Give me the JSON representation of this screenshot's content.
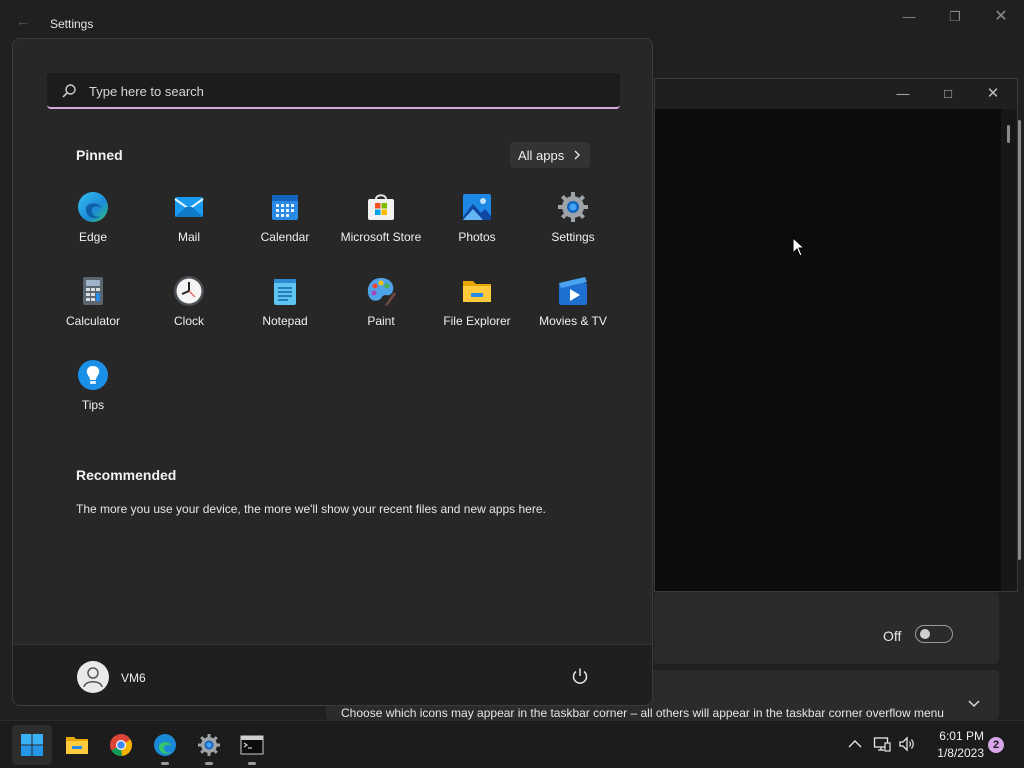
{
  "settings": {
    "title": "Settings",
    "toggle_state_label": "Off",
    "overflow_description": "Choose which icons may appear in the taskbar corner – all others will appear in the taskbar corner overflow menu"
  },
  "start_menu": {
    "search": {
      "placeholder": "Type here to search"
    },
    "pinned_title": "Pinned",
    "all_apps_label": "All apps",
    "pinned_apps": [
      {
        "label": "Edge",
        "icon": "edge-icon"
      },
      {
        "label": "Mail",
        "icon": "mail-icon"
      },
      {
        "label": "Calendar",
        "icon": "calendar-icon"
      },
      {
        "label": "Microsoft Store",
        "icon": "store-icon"
      },
      {
        "label": "Photos",
        "icon": "photos-icon"
      },
      {
        "label": "Settings",
        "icon": "gear-icon"
      },
      {
        "label": "Calculator",
        "icon": "calculator-icon"
      },
      {
        "label": "Clock",
        "icon": "clock-icon"
      },
      {
        "label": "Notepad",
        "icon": "notepad-icon"
      },
      {
        "label": "Paint",
        "icon": "paint-icon"
      },
      {
        "label": "File Explorer",
        "icon": "folder-icon"
      },
      {
        "label": "Movies & TV",
        "icon": "movies-icon"
      },
      {
        "label": "Tips",
        "icon": "lightbulb-icon"
      }
    ],
    "recommended_title": "Recommended",
    "recommended_text": "The more you use your device, the more we'll show your recent files and new apps here.",
    "user_name": "VM6"
  },
  "taskbar": {
    "time": "6:01 PM",
    "date": "1/8/2023",
    "notification_count": "2"
  },
  "colors": {
    "accent": "#d7a9e3",
    "start_bg": "#272727",
    "taskbar_bg": "#1c1c1c"
  }
}
